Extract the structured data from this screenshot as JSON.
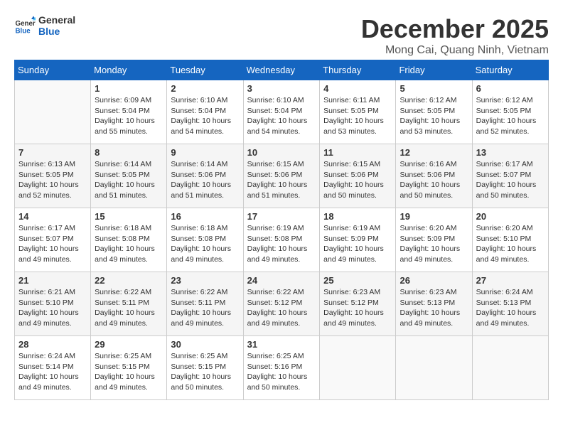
{
  "logo": {
    "general": "General",
    "blue": "Blue"
  },
  "title": "December 2025",
  "subtitle": "Mong Cai, Quang Ninh, Vietnam",
  "days_header": [
    "Sunday",
    "Monday",
    "Tuesday",
    "Wednesday",
    "Thursday",
    "Friday",
    "Saturday"
  ],
  "weeks": [
    [
      {
        "day": "",
        "info": ""
      },
      {
        "day": "1",
        "info": "Sunrise: 6:09 AM\nSunset: 5:04 PM\nDaylight: 10 hours\nand 55 minutes."
      },
      {
        "day": "2",
        "info": "Sunrise: 6:10 AM\nSunset: 5:04 PM\nDaylight: 10 hours\nand 54 minutes."
      },
      {
        "day": "3",
        "info": "Sunrise: 6:10 AM\nSunset: 5:04 PM\nDaylight: 10 hours\nand 54 minutes."
      },
      {
        "day": "4",
        "info": "Sunrise: 6:11 AM\nSunset: 5:05 PM\nDaylight: 10 hours\nand 53 minutes."
      },
      {
        "day": "5",
        "info": "Sunrise: 6:12 AM\nSunset: 5:05 PM\nDaylight: 10 hours\nand 53 minutes."
      },
      {
        "day": "6",
        "info": "Sunrise: 6:12 AM\nSunset: 5:05 PM\nDaylight: 10 hours\nand 52 minutes."
      }
    ],
    [
      {
        "day": "7",
        "info": "Sunrise: 6:13 AM\nSunset: 5:05 PM\nDaylight: 10 hours\nand 52 minutes."
      },
      {
        "day": "8",
        "info": "Sunrise: 6:14 AM\nSunset: 5:05 PM\nDaylight: 10 hours\nand 51 minutes."
      },
      {
        "day": "9",
        "info": "Sunrise: 6:14 AM\nSunset: 5:06 PM\nDaylight: 10 hours\nand 51 minutes."
      },
      {
        "day": "10",
        "info": "Sunrise: 6:15 AM\nSunset: 5:06 PM\nDaylight: 10 hours\nand 51 minutes."
      },
      {
        "day": "11",
        "info": "Sunrise: 6:15 AM\nSunset: 5:06 PM\nDaylight: 10 hours\nand 50 minutes."
      },
      {
        "day": "12",
        "info": "Sunrise: 6:16 AM\nSunset: 5:06 PM\nDaylight: 10 hours\nand 50 minutes."
      },
      {
        "day": "13",
        "info": "Sunrise: 6:17 AM\nSunset: 5:07 PM\nDaylight: 10 hours\nand 50 minutes."
      }
    ],
    [
      {
        "day": "14",
        "info": "Sunrise: 6:17 AM\nSunset: 5:07 PM\nDaylight: 10 hours\nand 49 minutes."
      },
      {
        "day": "15",
        "info": "Sunrise: 6:18 AM\nSunset: 5:08 PM\nDaylight: 10 hours\nand 49 minutes."
      },
      {
        "day": "16",
        "info": "Sunrise: 6:18 AM\nSunset: 5:08 PM\nDaylight: 10 hours\nand 49 minutes."
      },
      {
        "day": "17",
        "info": "Sunrise: 6:19 AM\nSunset: 5:08 PM\nDaylight: 10 hours\nand 49 minutes."
      },
      {
        "day": "18",
        "info": "Sunrise: 6:19 AM\nSunset: 5:09 PM\nDaylight: 10 hours\nand 49 minutes."
      },
      {
        "day": "19",
        "info": "Sunrise: 6:20 AM\nSunset: 5:09 PM\nDaylight: 10 hours\nand 49 minutes."
      },
      {
        "day": "20",
        "info": "Sunrise: 6:20 AM\nSunset: 5:10 PM\nDaylight: 10 hours\nand 49 minutes."
      }
    ],
    [
      {
        "day": "21",
        "info": "Sunrise: 6:21 AM\nSunset: 5:10 PM\nDaylight: 10 hours\nand 49 minutes."
      },
      {
        "day": "22",
        "info": "Sunrise: 6:22 AM\nSunset: 5:11 PM\nDaylight: 10 hours\nand 49 minutes."
      },
      {
        "day": "23",
        "info": "Sunrise: 6:22 AM\nSunset: 5:11 PM\nDaylight: 10 hours\nand 49 minutes."
      },
      {
        "day": "24",
        "info": "Sunrise: 6:22 AM\nSunset: 5:12 PM\nDaylight: 10 hours\nand 49 minutes."
      },
      {
        "day": "25",
        "info": "Sunrise: 6:23 AM\nSunset: 5:12 PM\nDaylight: 10 hours\nand 49 minutes."
      },
      {
        "day": "26",
        "info": "Sunrise: 6:23 AM\nSunset: 5:13 PM\nDaylight: 10 hours\nand 49 minutes."
      },
      {
        "day": "27",
        "info": "Sunrise: 6:24 AM\nSunset: 5:13 PM\nDaylight: 10 hours\nand 49 minutes."
      }
    ],
    [
      {
        "day": "28",
        "info": "Sunrise: 6:24 AM\nSunset: 5:14 PM\nDaylight: 10 hours\nand 49 minutes."
      },
      {
        "day": "29",
        "info": "Sunrise: 6:25 AM\nSunset: 5:15 PM\nDaylight: 10 hours\nand 49 minutes."
      },
      {
        "day": "30",
        "info": "Sunrise: 6:25 AM\nSunset: 5:15 PM\nDaylight: 10 hours\nand 50 minutes."
      },
      {
        "day": "31",
        "info": "Sunrise: 6:25 AM\nSunset: 5:16 PM\nDaylight: 10 hours\nand 50 minutes."
      },
      {
        "day": "",
        "info": ""
      },
      {
        "day": "",
        "info": ""
      },
      {
        "day": "",
        "info": ""
      }
    ]
  ]
}
